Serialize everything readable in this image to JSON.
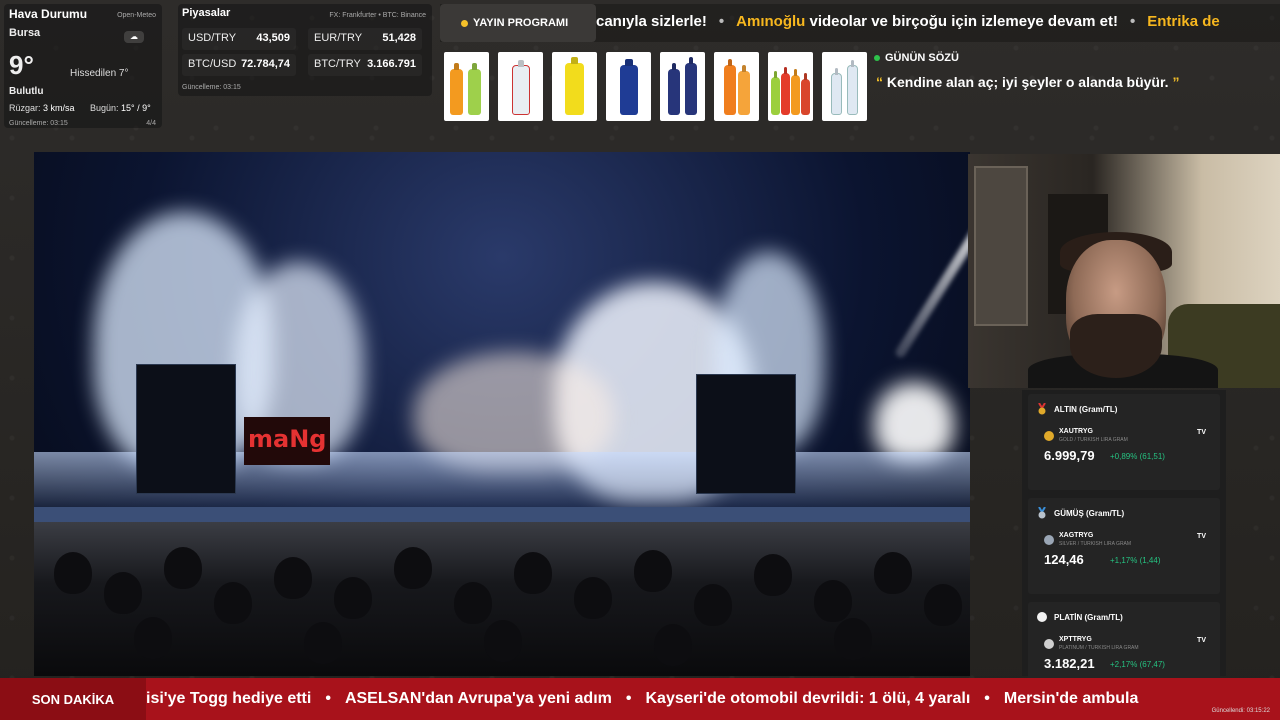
{
  "weather": {
    "title": "Hava Durumu",
    "source": "Open-Meteo",
    "city": "Bursa",
    "temp": "9°",
    "feels": "Hissedilen 7°",
    "condition": "Bulutlu",
    "wind_label": "Rüzgar:",
    "wind": "3 km/sa",
    "today_label": "Bugün:",
    "today": "15° / 9°",
    "updated": "Güncelleme: 03:15",
    "page": "4/4"
  },
  "markets": {
    "title": "Piyasalar",
    "source": "FX: Frankfurter • BTC: Binance",
    "rates": [
      {
        "label": "USD/TRY",
        "value": "43,509"
      },
      {
        "label": "EUR/TRY",
        "value": "51,428"
      },
      {
        "label": "BTC/USD",
        "value": "72.784,74"
      },
      {
        "label": "BTC/TRY",
        "value": "3.166.791"
      }
    ],
    "updated": "Güncelleme: 03:15"
  },
  "top_ticker": {
    "schedule_label": "YAYIN PROGRAMI",
    "seg1": "canıyla sizlerle!",
    "seg2_hl": "Amınoğlu",
    "seg2": " videolar ve birçoğu için izlemeye devam et!",
    "seg3_hl": "Entrika de"
  },
  "quote": {
    "title": "GÜNÜN SÖZÜ",
    "text": "Kendine alan aç; iyi şeyler o alanda büyür."
  },
  "metals": [
    {
      "title": "ALTIN (Gram/TL)",
      "symbol": "XAUTRYG",
      "desc": "GOLD / TURKISH LIRA GRAM",
      "price": "6.999,79",
      "change": "+0,89% (61,51)",
      "color": "#e0a92a"
    },
    {
      "title": "GÜMÜŞ (Gram/TL)",
      "symbol": "XAGTRYG",
      "desc": "SILVER / TURKISH LIRA GRAM",
      "price": "124,46",
      "change": "+1,17% (1,44)",
      "color": "#9aa6b5"
    },
    {
      "title": "PLATİN (Gram/TL)",
      "symbol": "XPTTRYG",
      "desc": "PLATINUM / TURKISH LIRA GRAM",
      "price": "3.182,21",
      "change": "+2,17% (67,47)",
      "color": "#e8e8e8"
    }
  ],
  "tv_label": "TV",
  "video": {
    "sign": "maNg"
  },
  "breaking": {
    "label": "SON DAKİKA",
    "items": [
      "isi'ye Togg hediye etti",
      "ASELSAN'dan Avrupa'ya yeni adım",
      "Kayseri'de otomobil devrildi: 1 ölü, 4 yaralı",
      "Mersin'de ambula"
    ],
    "stamp": "Güncellendi: 03:15:22"
  },
  "colors": {
    "accent": "#f7b71e",
    "breaking": "#a8121b",
    "positive": "#26c281"
  }
}
